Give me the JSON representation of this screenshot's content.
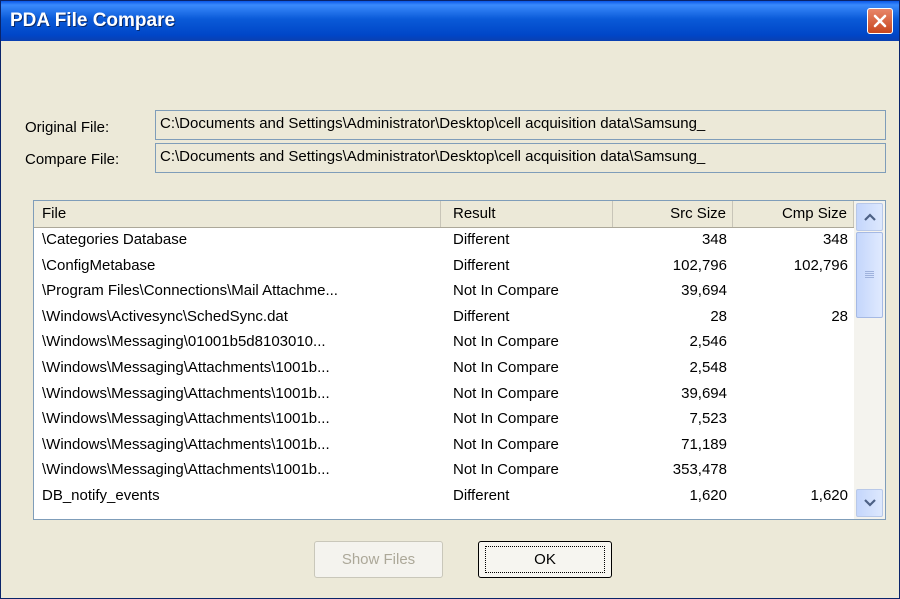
{
  "window": {
    "title": "PDA File Compare"
  },
  "fields": {
    "original_label": "Original File:",
    "original_value": "C:\\Documents and Settings\\Administrator\\Desktop\\cell acquisition data\\Samsung_",
    "compare_label": "Compare File:",
    "compare_value": "C:\\Documents and Settings\\Administrator\\Desktop\\cell acquisition data\\Samsung_"
  },
  "table": {
    "columns": [
      "File",
      "Result",
      "Src Size",
      "Cmp Size"
    ],
    "rows": [
      {
        "file": "\\Categories Database",
        "result": "Different",
        "src": "348",
        "cmp": "348"
      },
      {
        "file": "\\ConfigMetabase",
        "result": "Different",
        "src": "102,796",
        "cmp": "102,796"
      },
      {
        "file": "\\Program Files\\Connections\\Mail Attachme...",
        "result": "Not In Compare",
        "src": "39,694",
        "cmp": ""
      },
      {
        "file": "\\Windows\\Activesync\\SchedSync.dat",
        "result": "Different",
        "src": "28",
        "cmp": "28"
      },
      {
        "file": "\\Windows\\Messaging\\01001b5d8103010...",
        "result": "Not In Compare",
        "src": "2,546",
        "cmp": ""
      },
      {
        "file": "\\Windows\\Messaging\\Attachments\\1001b...",
        "result": "Not In Compare",
        "src": "2,548",
        "cmp": ""
      },
      {
        "file": "\\Windows\\Messaging\\Attachments\\1001b...",
        "result": "Not In Compare",
        "src": "39,694",
        "cmp": ""
      },
      {
        "file": "\\Windows\\Messaging\\Attachments\\1001b...",
        "result": "Not In Compare",
        "src": "7,523",
        "cmp": ""
      },
      {
        "file": "\\Windows\\Messaging\\Attachments\\1001b...",
        "result": "Not In Compare",
        "src": "71,189",
        "cmp": ""
      },
      {
        "file": "\\Windows\\Messaging\\Attachments\\1001b...",
        "result": "Not In Compare",
        "src": "353,478",
        "cmp": ""
      },
      {
        "file": "DB_notify_events",
        "result": "Different",
        "src": "1,620",
        "cmp": "1,620"
      }
    ]
  },
  "buttons": {
    "show_files": "Show Files",
    "ok": "OK"
  },
  "icons": {
    "close": "close-icon",
    "scroll_up": "chevron-up-icon",
    "scroll_down": "chevron-down-icon"
  },
  "colors": {
    "titlebar": "#0a5ad8",
    "dialog_bg": "#ece9d8",
    "close_button": "#d9572f"
  }
}
